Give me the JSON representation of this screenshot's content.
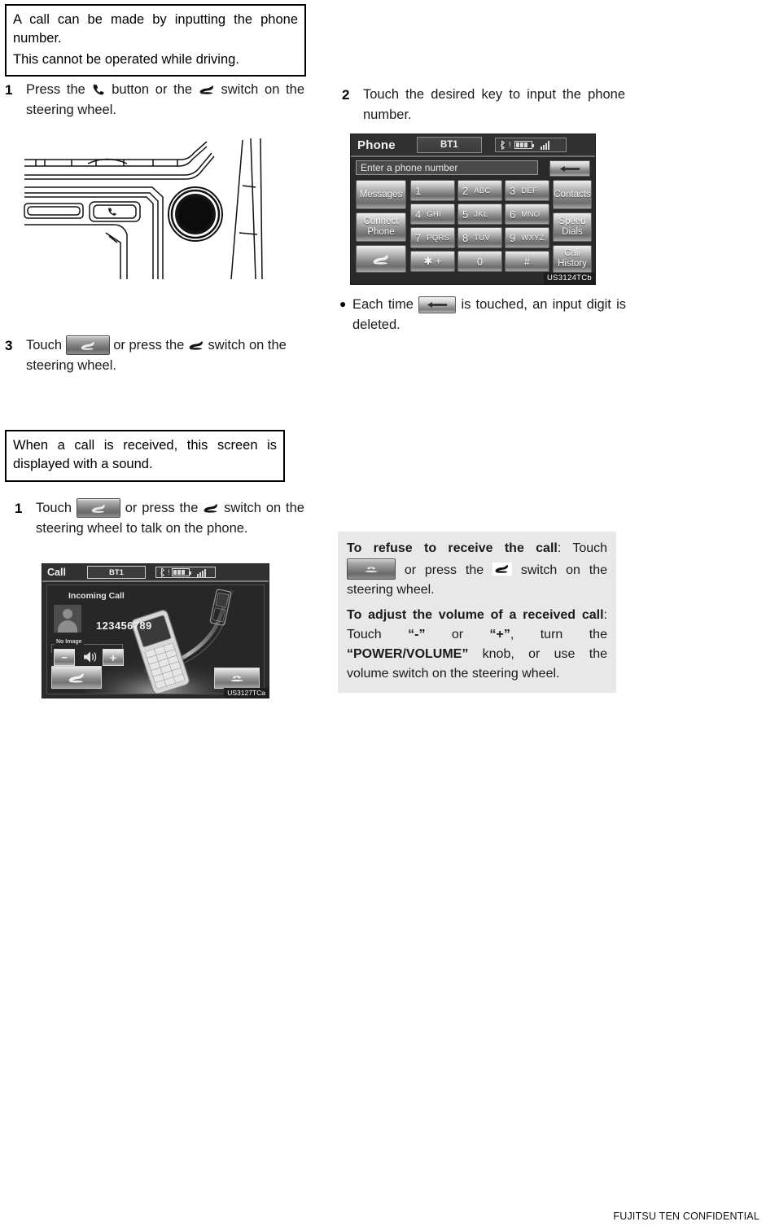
{
  "document": {
    "footer": "FUJITSU TEN CONFIDENTIAL"
  },
  "left_column": {
    "callout_dial": {
      "line1": "A call can be made by inputting the phone number.",
      "line2": "This cannot be operated while driving."
    },
    "step1": {
      "number": "1",
      "text_before": "Press the",
      "text_middle": "button or the",
      "text_after": "switch on the steering wheel."
    },
    "step3": {
      "number": "3",
      "text_before": "Touch",
      "text_middle": "or press the",
      "text_after": "switch on the steering wheel."
    },
    "callout_receive": {
      "line1": "When a call is received, this screen is displayed with a sound."
    },
    "receive_step1": {
      "number": "1",
      "text_before": "Touch",
      "text_middle": "or press the",
      "text_after": "switch on the steering wheel to talk on the phone."
    }
  },
  "right_column": {
    "step2": {
      "number": "2",
      "text": "Touch the desired key to input the phone number."
    },
    "bullet_delete": {
      "dot": "●",
      "text_before": "Each time",
      "text_after": "is touched, an input digit is deleted."
    },
    "info_panel": {
      "refuse_lead": "To refuse to receive the call",
      "refuse_colon": ": Touch",
      "refuse_mid": "or press the",
      "refuse_tail": "switch on the steering wheel.",
      "volume_lead": "To adjust the volume of a received call",
      "volume_colon": ": Touch",
      "volume_minus": "“-”",
      "volume_or": "or",
      "volume_plus": "“+”",
      "volume_turn": ", turn the",
      "volume_knob": "“POWER/VOLUME”",
      "volume_tail": "knob, or use the volume switch on the steering wheel."
    }
  },
  "phone_screen": {
    "title": "Phone",
    "bt_label": "BT1",
    "input_placeholder": "Enter a phone number",
    "delete_icon": "left-arrow-icon",
    "left_buttons": [
      {
        "label": "Messages"
      },
      {
        "label_line1": "Connect",
        "label_line2": "Phone"
      },
      {
        "label": "",
        "icon": "handset-icon"
      }
    ],
    "keys": [
      {
        "num": "1",
        "alpha": ""
      },
      {
        "num": "2",
        "alpha": "ABC"
      },
      {
        "num": "3",
        "alpha": "DEF"
      },
      {
        "num": "4",
        "alpha": "GHI"
      },
      {
        "num": "5",
        "alpha": "JKL"
      },
      {
        "num": "6",
        "alpha": "MNO"
      },
      {
        "num": "7",
        "alpha": "PQRS"
      },
      {
        "num": "8",
        "alpha": "TUV"
      },
      {
        "num": "9",
        "alpha": "WXYZ"
      },
      {
        "num": "✱ +",
        "alpha": ""
      },
      {
        "num": "0",
        "alpha": ""
      },
      {
        "num": "#",
        "alpha": ""
      }
    ],
    "right_buttons": [
      {
        "label": "Contacts"
      },
      {
        "label_line1": "Speed",
        "label_line2": "Dials"
      },
      {
        "label_line1": "Call",
        "label_line2": "History"
      }
    ],
    "image_tag": "US3124TCb"
  },
  "call_screen": {
    "title": "Call",
    "bt_label": "BT1",
    "incoming_label": "Incoming Call",
    "number": "123456789",
    "no_image_label": "No Image",
    "minus_label": "−",
    "plus_label": "+",
    "speaker_icon": "speaker-icon",
    "answer_icon": "answer-call-icon",
    "hangup_icon": "hangup-call-icon",
    "image_tag": "US3127TCa"
  },
  "colors": {
    "page_bg": "#ffffff",
    "text": "#1a1a1a",
    "panel_bg": "#e8e8e8",
    "screen_bg": "#2a2a2a",
    "key_text": "#f7f7f7"
  }
}
